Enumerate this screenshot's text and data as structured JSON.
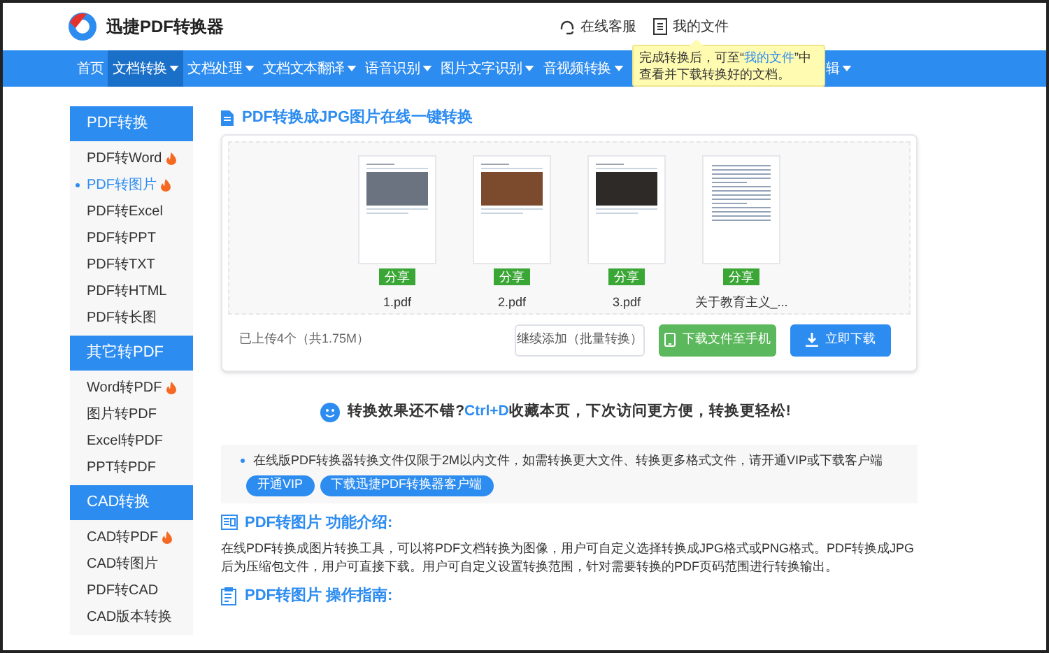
{
  "header": {
    "logo_text": "迅捷PDF转换器",
    "links": [
      {
        "kind": "headset",
        "label": "在线客服"
      },
      {
        "kind": "file",
        "label": "我的文件"
      }
    ]
  },
  "nav": {
    "items": [
      {
        "label": "首页",
        "selected": false,
        "caret": false
      },
      {
        "label": "文档转换",
        "selected": true,
        "caret": true
      },
      {
        "label": "文档处理",
        "selected": false,
        "caret": true
      },
      {
        "label": "文档文本翻译",
        "selected": false,
        "caret": true
      },
      {
        "label": "语音识别",
        "selected": false,
        "caret": true
      },
      {
        "label": "图片文字识别",
        "selected": false,
        "caret": true
      },
      {
        "label": "音视频转换",
        "selected": false,
        "caret": true
      },
      {
        "label": "辑",
        "selected": false,
        "caret": true
      }
    ]
  },
  "tooltip": {
    "before": "完成转换后，可至“",
    "link": "我的文件",
    "after": "”中查看并下载转换好的文档。"
  },
  "sidebar": {
    "groups": [
      {
        "title": "PDF转换",
        "items": [
          {
            "label": "PDF转Word",
            "hot": true,
            "selected": false
          },
          {
            "label": "PDF转图片",
            "hot": true,
            "selected": true
          },
          {
            "label": "PDF转Excel",
            "hot": false,
            "selected": false
          },
          {
            "label": "PDF转PPT",
            "hot": false,
            "selected": false
          },
          {
            "label": "PDF转TXT",
            "hot": false,
            "selected": false
          },
          {
            "label": "PDF转HTML",
            "hot": false,
            "selected": false
          },
          {
            "label": "PDF转长图",
            "hot": false,
            "selected": false
          }
        ]
      },
      {
        "title": "其它转PDF",
        "items": [
          {
            "label": "Word转PDF",
            "hot": true,
            "selected": false
          },
          {
            "label": "图片转PDF",
            "hot": false,
            "selected": false
          },
          {
            "label": "Excel转PDF",
            "hot": false,
            "selected": false
          },
          {
            "label": "PPT转PDF",
            "hot": false,
            "selected": false
          }
        ]
      },
      {
        "title": "CAD转换",
        "items": [
          {
            "label": "CAD转PDF",
            "hot": true,
            "selected": false
          },
          {
            "label": "CAD转图片",
            "hot": false,
            "selected": false
          },
          {
            "label": "PDF转CAD",
            "hot": false,
            "selected": false
          },
          {
            "label": "CAD版本转换",
            "hot": false,
            "selected": false
          }
        ]
      }
    ]
  },
  "main": {
    "title": "PDF转换成JPG图片在线一键转换",
    "files": [
      {
        "name": "1.pdf",
        "share": "分享",
        "kind": "photo"
      },
      {
        "name": "2.pdf",
        "share": "分享",
        "kind": "photo"
      },
      {
        "name": "3.pdf",
        "share": "分享",
        "kind": "photo"
      },
      {
        "name": "关于教育主义_...",
        "share": "分享",
        "kind": "text"
      }
    ],
    "summary": "已上传4个（共1.75M）",
    "buttons": [
      {
        "kind": "outline",
        "label": "继续添加（批量转换）"
      },
      {
        "kind": "phone",
        "label": "下载文件至手机"
      },
      {
        "kind": "download",
        "label": "立即下载"
      }
    ],
    "feedback": {
      "before": "转换效果还不错?",
      "shortcut": "Ctrl+D",
      "after": "收藏本页，下次访问更方便，转换更轻松!"
    },
    "notice": {
      "text": "在线版PDF转换器转换文件仅限于2M以内文件，如需转换更大文件、转换更多格式文件，请开通VIP或下载客户端",
      "buttons": [
        "开通VIP",
        "下载迅捷PDF转换器客户端"
      ]
    },
    "sections": [
      {
        "kind": "intro",
        "heading": "PDF转图片 功能介绍:",
        "text": "在线PDF转换成图片转换工具，可以将PDF文档转换为图像，用户可自定义选择转换成JPG格式或PNG格式。PDF转换成JPG后为压缩包文件，用户可直接下载。用户可自定义设置转换范围，针对需要转换的PDF页码范围进行转换输出。"
      },
      {
        "kind": "guide",
        "heading": "PDF转图片 操作指南:"
      }
    ]
  }
}
